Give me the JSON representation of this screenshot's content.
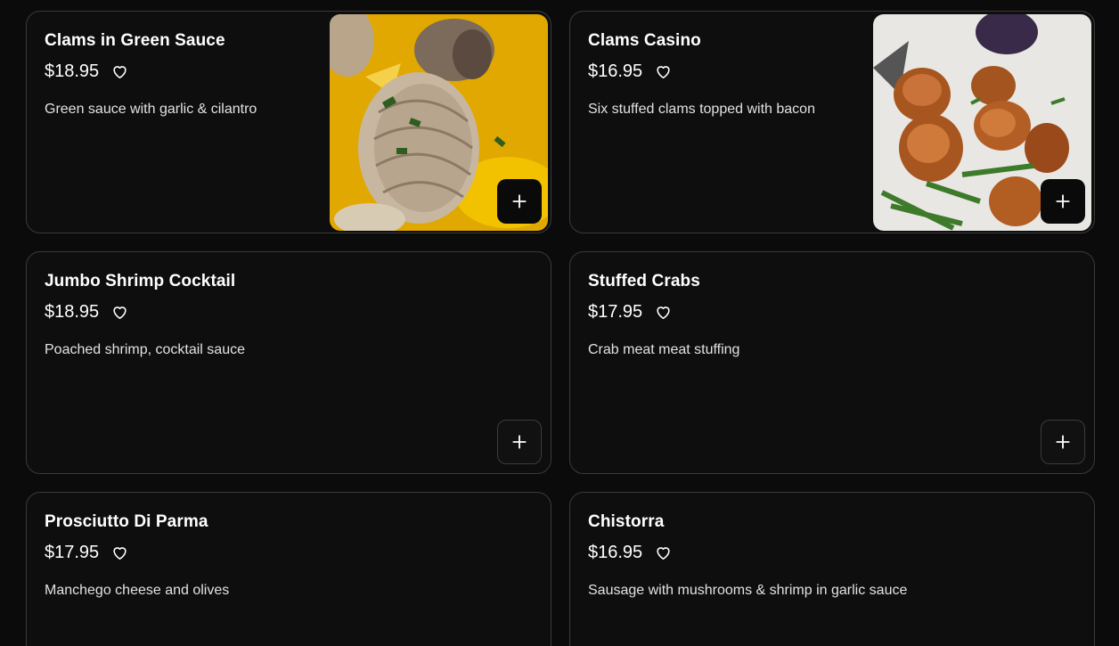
{
  "menu": {
    "items": [
      {
        "name": "Clams in Green Sauce",
        "price": "$18.95",
        "description": "Green sauce with garlic & cilantro",
        "has_image": true,
        "image_icon": "clams-in-broth-photo"
      },
      {
        "name": "Clams Casino",
        "price": "$16.95",
        "description": "Six stuffed clams topped with bacon",
        "has_image": true,
        "image_icon": "stuffed-clams-photo"
      },
      {
        "name": "Jumbo Shrimp Cocktail",
        "price": "$18.95",
        "description": "Poached shrimp, cocktail sauce",
        "has_image": false
      },
      {
        "name": "Stuffed Crabs",
        "price": "$17.95",
        "description": "Crab meat meat stuffing",
        "has_image": false
      },
      {
        "name": "Prosciutto Di Parma",
        "price": "$17.95",
        "description": "Manchego cheese and olives",
        "has_image": false
      },
      {
        "name": "Chistorra",
        "price": "$16.95",
        "description": "Sausage with mushrooms & shrimp in garlic sauce",
        "has_image": false
      }
    ]
  },
  "icons": {
    "favorite": "heart-outline-icon",
    "add": "plus-icon"
  },
  "colors": {
    "background": "#0b0b0b",
    "card": "#0e0e0e",
    "card_border": "#3a3a3a",
    "text": "#ffffff",
    "muted_text": "#e2e2e2"
  }
}
